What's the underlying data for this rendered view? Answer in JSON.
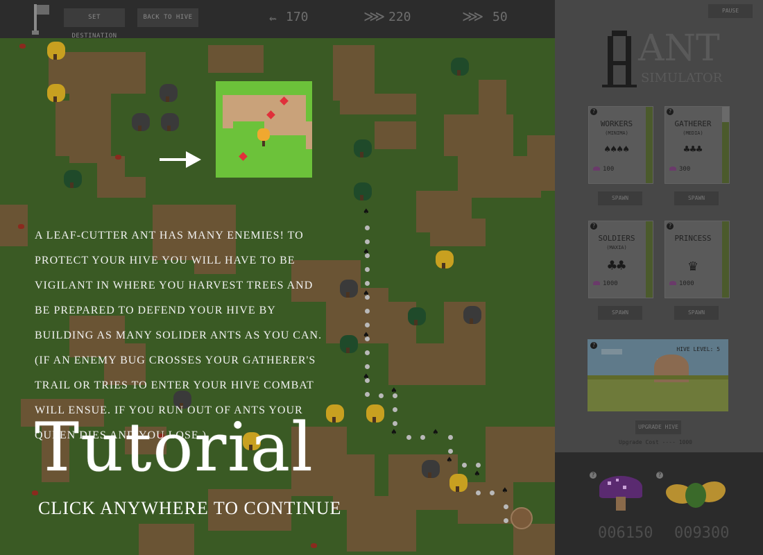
{
  "topbar": {
    "set_destination": "SET DESTINATION",
    "back_to_hive": "BACK TO HIVE",
    "resources": [
      {
        "icon": "worker-ant-icon",
        "value": "170"
      },
      {
        "icon": "gatherer-ant-icon",
        "value": "220"
      },
      {
        "icon": "soldier-ant-icon",
        "value": "50"
      }
    ]
  },
  "sidebar": {
    "pause": "PAUSE",
    "logo_main": "ANT",
    "logo_sub": "SIMULATOR",
    "cards": [
      {
        "title": "WORKERS",
        "sub": "(MINIMA)",
        "ants": "♠♠♠♠",
        "cost": "100",
        "spawn": "SPAWN",
        "help": "?"
      },
      {
        "title": "GATHERER",
        "sub": "(MEDIA)",
        "ants": "♣♣♣",
        "cost": "300",
        "spawn": "SPAWN",
        "help": "?"
      },
      {
        "title": "SOLDIERS",
        "sub": "(MAXIA)",
        "ants": "♣♣",
        "cost": "1000",
        "spawn": "SPAWN",
        "help": "?"
      },
      {
        "title": "PRINCESS",
        "sub": "",
        "ants": "♛",
        "cost": "1000",
        "spawn": "SPAWN",
        "help": "?"
      }
    ],
    "hive": {
      "label": "HIVE LEVEL: 5",
      "upgrade": "UPGRADE HIVE",
      "upgrade_cost": "Upgrade Cost ---- 1000",
      "help": "?"
    },
    "stock": {
      "mushroom": "006150",
      "leaves": "009300",
      "help": "?"
    }
  },
  "tutorial": {
    "text": "A leaf-cutter ant has many enemies! To protect your hive you will have to be vigilant in where you harvest trees and be prepared to defend your hive by building as many solider ants as you can. (If an enemy bug crosses your gatherer's trail or tries to enter your hive combat will ensue. If you run out of ants your queen dies and you lose.)",
    "title": "Tutorial",
    "continue": "CLICK ANYWHERE TO CONTINUE"
  },
  "colors": {
    "grass": "#3a5a24",
    "dirt": "#6b5a3a",
    "sidebar": "#474747",
    "accent_leaf": "#f0a830"
  }
}
